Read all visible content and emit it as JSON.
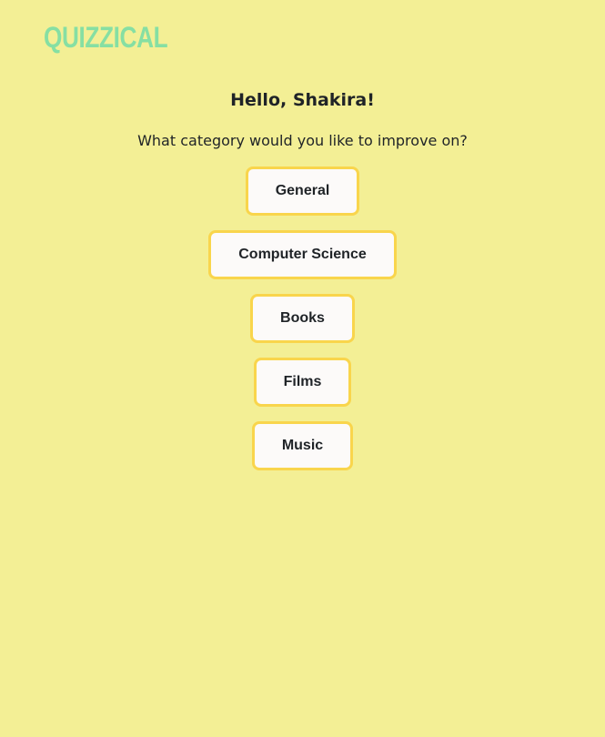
{
  "app": {
    "logo": "QUIZZICAL"
  },
  "main": {
    "greeting": "Hello, Shakira!",
    "prompt": "What category would you like to improve on?",
    "categories": [
      {
        "label": "General"
      },
      {
        "label": "Computer Science"
      },
      {
        "label": "Books"
      },
      {
        "label": "Films"
      },
      {
        "label": "Music"
      }
    ]
  },
  "colors": {
    "background": "#f3ef95",
    "logo": "#86dfa3",
    "button_border": "#f9d54c",
    "button_bg": "#fcfaf9",
    "text": "#1f2327"
  }
}
